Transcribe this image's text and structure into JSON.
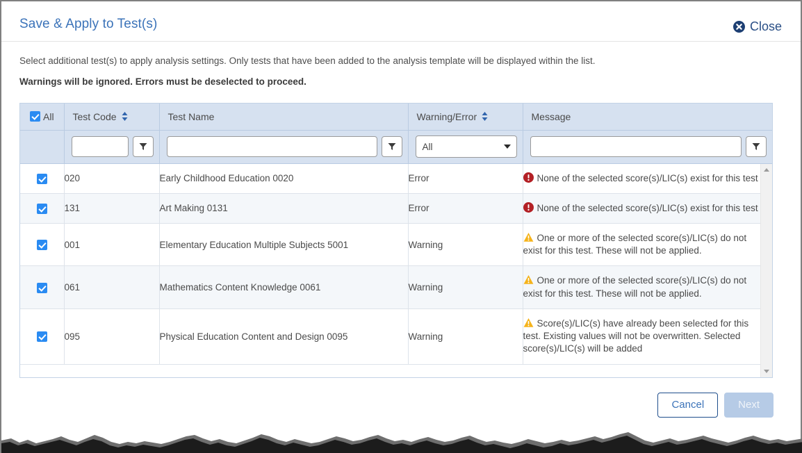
{
  "dialog": {
    "title": "Save & Apply to Test(s)",
    "close_label": "Close",
    "close_icon": "close-circle-icon",
    "intro": "Select additional test(s) to apply analysis settings. Only tests that have been added to the analysis template will be displayed within the list.",
    "warning_note": "Warnings will be ignored. Errors must be deselected to proceed."
  },
  "grid": {
    "select_all": {
      "label": "All",
      "checked": true
    },
    "columns": [
      {
        "key": "select",
        "label": "All",
        "sortable": false
      },
      {
        "key": "test_code",
        "label": "Test Code",
        "sortable": true
      },
      {
        "key": "test_name",
        "label": "Test Name",
        "sortable": false
      },
      {
        "key": "warning_error",
        "label": "Warning/Error",
        "sortable": true
      },
      {
        "key": "message",
        "label": "Message",
        "sortable": false
      }
    ],
    "filters": {
      "test_code": {
        "value": "",
        "placeholder": "",
        "button_icon": "filter-funnel-icon"
      },
      "test_name": {
        "value": "",
        "placeholder": "",
        "button_icon": "filter-funnel-icon"
      },
      "warning_error": {
        "selected": "All",
        "options": [
          "All",
          "Warning",
          "Error"
        ]
      },
      "message": {
        "value": "",
        "placeholder": "",
        "button_icon": "filter-funnel-icon"
      }
    },
    "rows": [
      {
        "checked": true,
        "test_code": "020",
        "test_name": "Early Childhood Education 0020",
        "warning_error": "Error",
        "severity_icon": "error-icon",
        "message": "None of the selected score(s)/LIC(s) exist for this test"
      },
      {
        "checked": true,
        "test_code": "131",
        "test_name": "Art Making 0131",
        "warning_error": "Error",
        "severity_icon": "error-icon",
        "message": "None of the selected score(s)/LIC(s) exist for this test"
      },
      {
        "checked": true,
        "test_code": "001",
        "test_name": "Elementary Education Multiple Subjects 5001",
        "warning_error": "Warning",
        "severity_icon": "warning-icon",
        "message": "One or more of the selected score(s)/LIC(s) do not exist for this test. These will not be applied."
      },
      {
        "checked": true,
        "test_code": "061",
        "test_name": "Mathematics Content Knowledge 0061",
        "warning_error": "Warning",
        "severity_icon": "warning-icon",
        "message": "One or more of the selected score(s)/LIC(s) do not exist for this test. These will not be applied."
      },
      {
        "checked": true,
        "test_code": "095",
        "test_name": "Physical Education Content and Design 0095",
        "warning_error": "Warning",
        "severity_icon": "warning-icon",
        "message": "Score(s)/LIC(s) have already been selected for this test. Existing values will not be overwritten. Selected score(s)/LIC(s) will be added"
      }
    ],
    "scrollbar": {
      "up_icon": "scroll-up-arrow-icon",
      "down_icon": "scroll-down-arrow-icon"
    }
  },
  "footer": {
    "cancel_label": "Cancel",
    "next_label": "Next",
    "next_disabled": true
  },
  "colors": {
    "title_blue": "#3b73b9",
    "header_bg": "#d6e1f0",
    "error_red": "#b32025",
    "warning_amber": "#f5b31b",
    "checkbox_blue": "#2a8bf2",
    "alt_row": "#f4f7fa",
    "next_disabled_bg": "#b6cbe6"
  }
}
